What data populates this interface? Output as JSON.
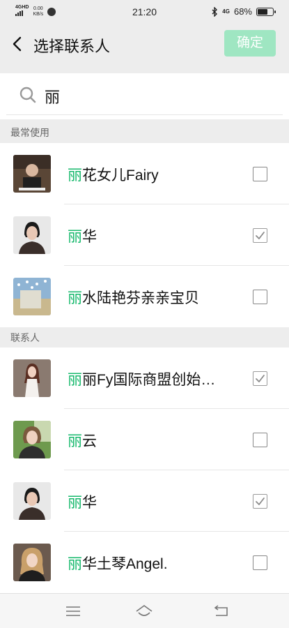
{
  "status_bar": {
    "network": "4G",
    "network_hd": "HD",
    "speed_value": "0.00",
    "speed_unit": "KB/s",
    "time": "21:20",
    "right_network": "4G",
    "battery_text": "68%",
    "battery_level": 0.68,
    "icons": [
      "signal-icon",
      "wechat-icon",
      "bluetooth-icon",
      "battery-icon"
    ]
  },
  "header": {
    "title": "选择联系人",
    "confirm_label": "确定",
    "confirm_color": "#9fe6c2"
  },
  "search": {
    "value": "丽",
    "icon": "search-icon"
  },
  "highlight_color": "#14b86b",
  "sections": [
    {
      "title": "最常使用",
      "contacts": [
        {
          "highlight": "丽",
          "rest": "花女儿Fairy",
          "checked": false
        },
        {
          "highlight": "丽",
          "rest": "华",
          "checked": true
        },
        {
          "highlight": "丽",
          "rest": "水陆艳芬亲亲宝贝",
          "checked": false
        }
      ]
    },
    {
      "title": "联系人",
      "contacts": [
        {
          "highlight": "丽",
          "rest": "丽Fy国际商盟创始…",
          "checked": true
        },
        {
          "highlight": "丽",
          "rest": "云",
          "checked": false
        },
        {
          "highlight": "丽",
          "rest": "华",
          "checked": true
        },
        {
          "highlight": "丽",
          "rest": "华土琴Angel.",
          "checked": false
        }
      ]
    }
  ],
  "nav_bar": {
    "icons": [
      "menu-icon",
      "home-icon",
      "back-nav-icon"
    ]
  }
}
